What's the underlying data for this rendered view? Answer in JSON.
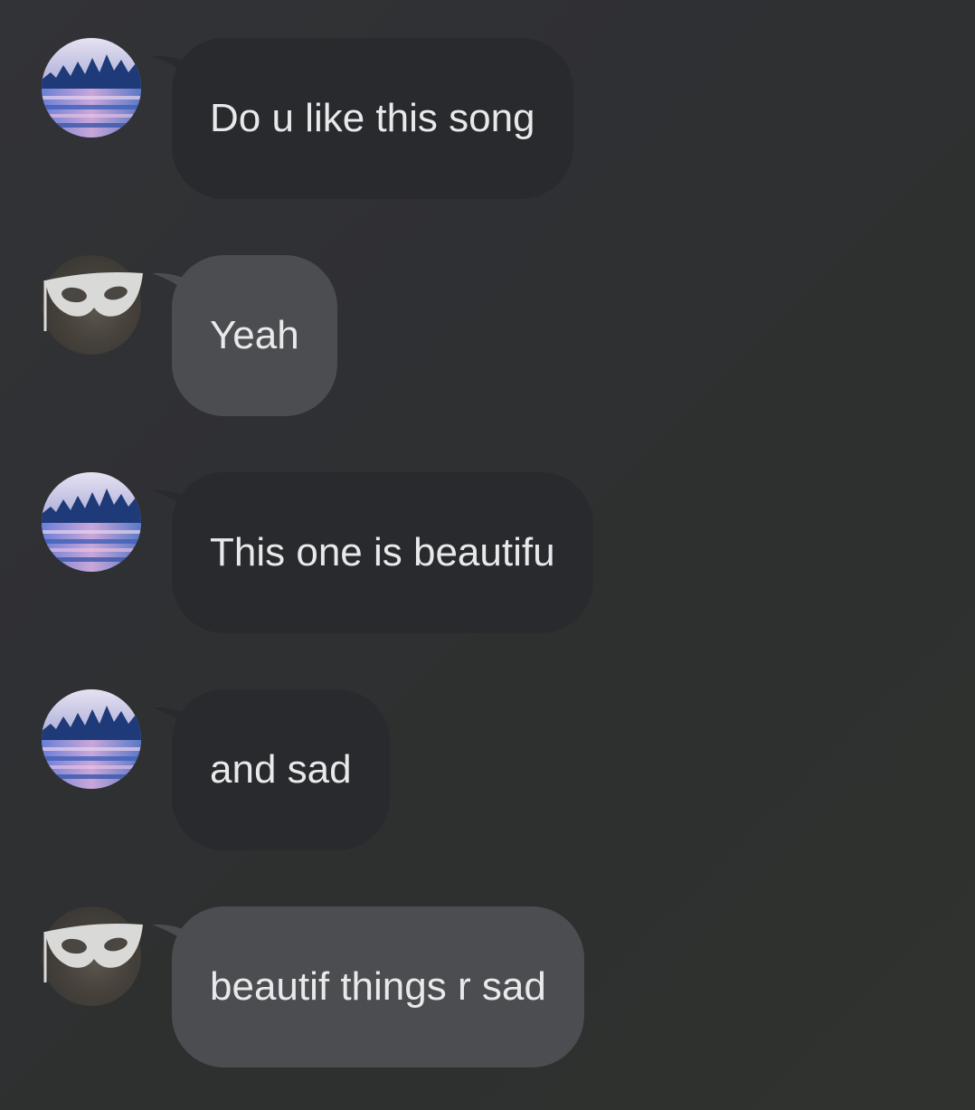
{
  "messages": [
    {
      "text": "Do u like this song",
      "sender": "lake-avatar",
      "bubble": "dark"
    },
    {
      "text": "Yeah",
      "sender": "mask-avatar",
      "bubble": "light"
    },
    {
      "text": "This one is beautifu",
      "sender": "lake-avatar",
      "bubble": "dark"
    },
    {
      "text": "and sad",
      "sender": "lake-avatar",
      "bubble": "dark"
    },
    {
      "text": "beautif things r sad",
      "sender": "mask-avatar",
      "bubble": "light"
    }
  ],
  "colors": {
    "background": "#303134",
    "bubble_dark": "#292a2d",
    "bubble_light": "#4b4d50",
    "text": "#e8e9ea"
  }
}
